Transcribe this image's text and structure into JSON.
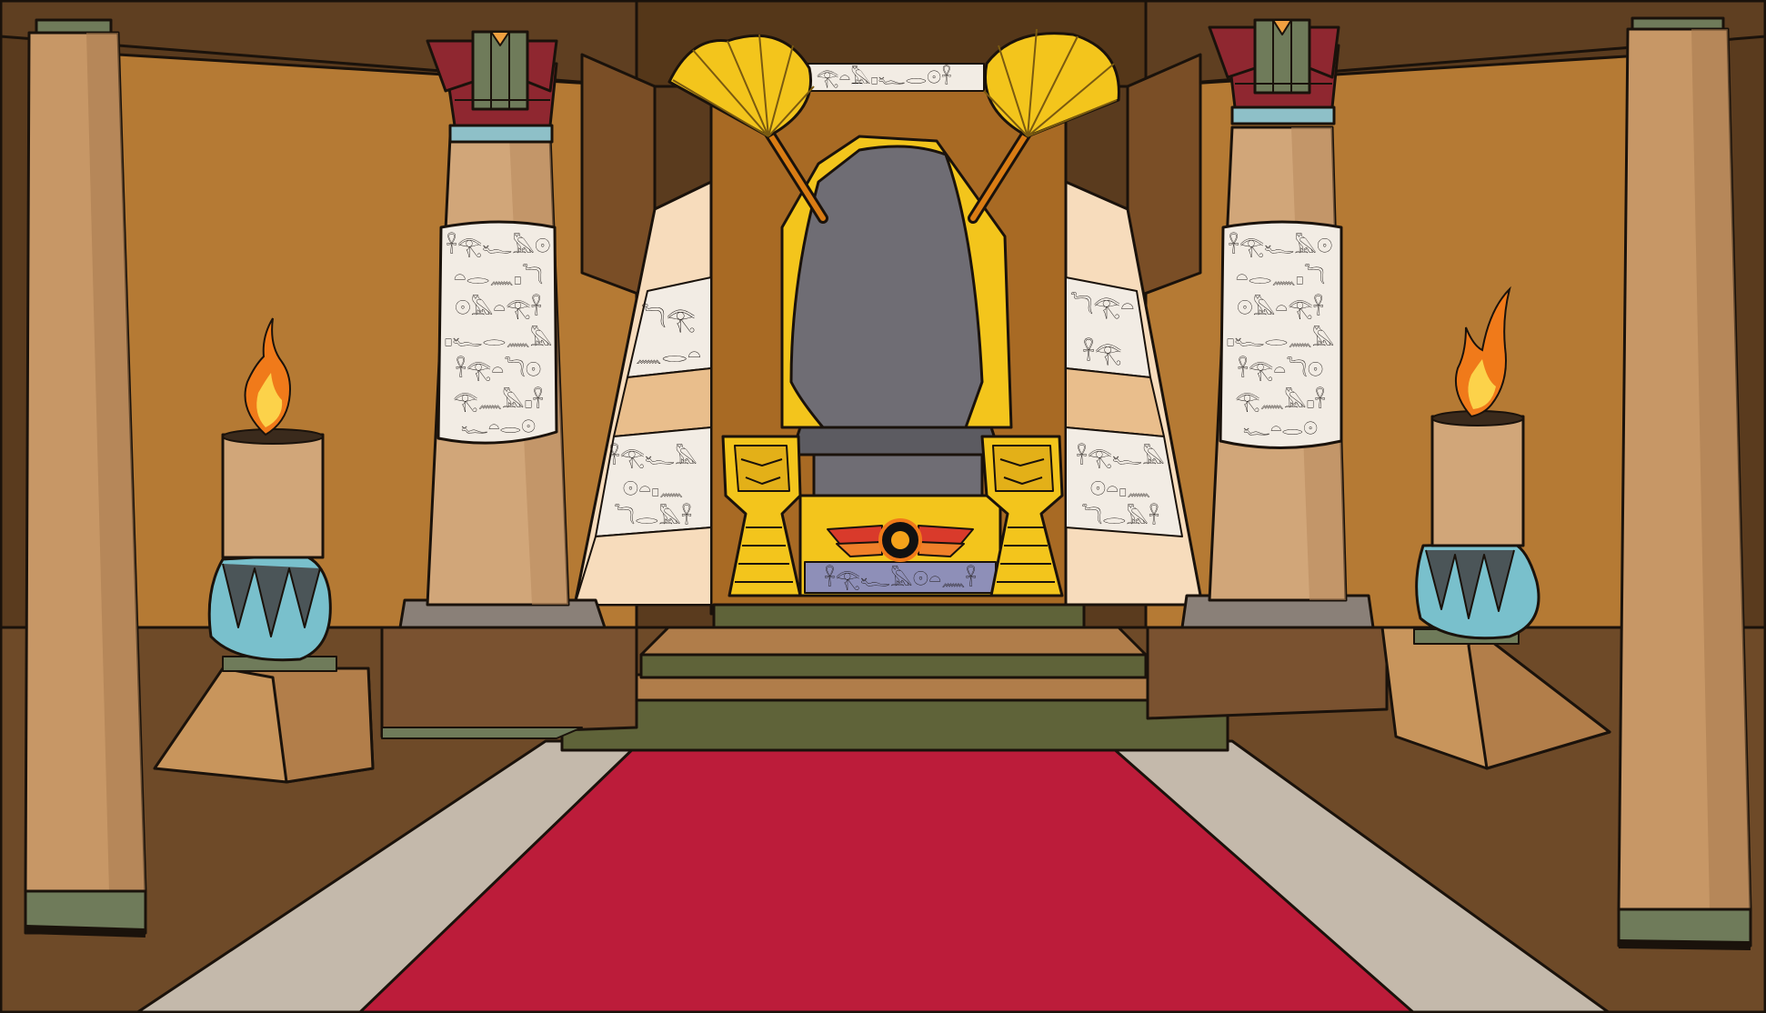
{
  "scene": {
    "type": "illustrated game background",
    "setting": "egyptian-throne-room",
    "colors": {
      "wall": "#b57a34",
      "wall_dark": "#6b4320",
      "ceiling": "#5a3b1e",
      "floor": "#6e4a28",
      "pillar_sand": "#d1a679",
      "pillar_shadow": "#b8895c",
      "hieroglyph_band": "#f2ece4",
      "gold": "#f3c51c",
      "gold_dark": "#c99a0c",
      "throne_stone": "#6f6d74",
      "carpet": "#bc1c3a",
      "aisle_stone": "#c4b9ab",
      "step": "#b07d4a",
      "step_trim": "#5f6339",
      "capital_red": "#8f2730",
      "capital_green": "#6f7b5a",
      "capital_blue": "#8ec0c8",
      "flame_orange": "#f07a1a",
      "flame_yellow": "#fcd24a",
      "brazier_blue": "#79c0cc",
      "brazier_dark": "#4b5558"
    }
  }
}
